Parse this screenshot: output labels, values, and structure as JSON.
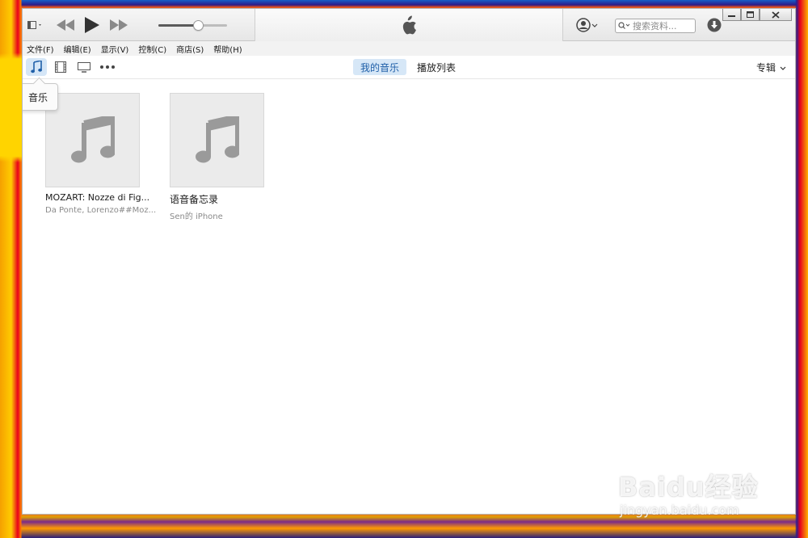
{
  "menubar": {
    "items": [
      "文件(F)",
      "编辑(E)",
      "显示(V)",
      "控制(C)",
      "商店(S)",
      "帮助(H)"
    ]
  },
  "search": {
    "placeholder": "搜索资料..."
  },
  "volume": {
    "level": 0.58
  },
  "toolbar": {
    "media": [
      {
        "name": "music-icon",
        "active": true
      },
      {
        "name": "movies-icon",
        "active": false
      },
      {
        "name": "tv-icon",
        "active": false
      },
      {
        "name": "more-icon",
        "active": false
      }
    ],
    "tabs": [
      {
        "label": "我的音乐",
        "active": true
      },
      {
        "label": "播放列表",
        "active": false
      }
    ],
    "sort_label": "专辑"
  },
  "tooltip": {
    "text": "音乐"
  },
  "albums": [
    {
      "title": "MOZART: Nozze di Fig...",
      "artist": "Da Ponte, Lorenzo##Moz..."
    },
    {
      "title": "语音备忘录",
      "artist": "Sen的 iPhone"
    }
  ],
  "watermark": {
    "logo": "Baidu经验",
    "url": "jingyan.baidu.com"
  },
  "colors": {
    "accent": "#1f5fa8",
    "tab_highlight": "#d6e7f7"
  }
}
